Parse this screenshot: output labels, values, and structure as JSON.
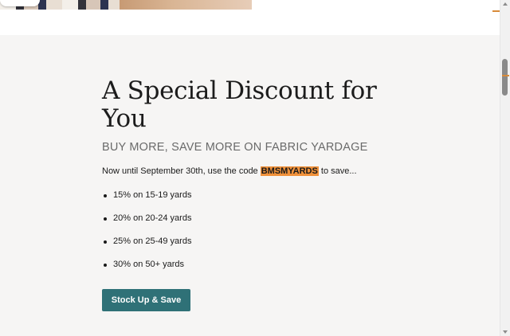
{
  "promo": {
    "title": "A Special Discount for You",
    "subtitle": "BUY MORE, SAVE MORE ON FABRIC YARDAGE",
    "intro_before": "Now until September 30th, use the code ",
    "code": "BMSMYARDS",
    "intro_after": " to save...",
    "tiers": [
      "15% on 15-19 yards",
      "20% on 20-24 yards",
      "25% on 25-49 yards",
      "30% on 50+ yards"
    ],
    "cta_label": "Stock Up & Save"
  },
  "colors": {
    "accent_button": "#2f7177",
    "code_highlight": "#f0913a",
    "background": "#f6f5f4"
  }
}
